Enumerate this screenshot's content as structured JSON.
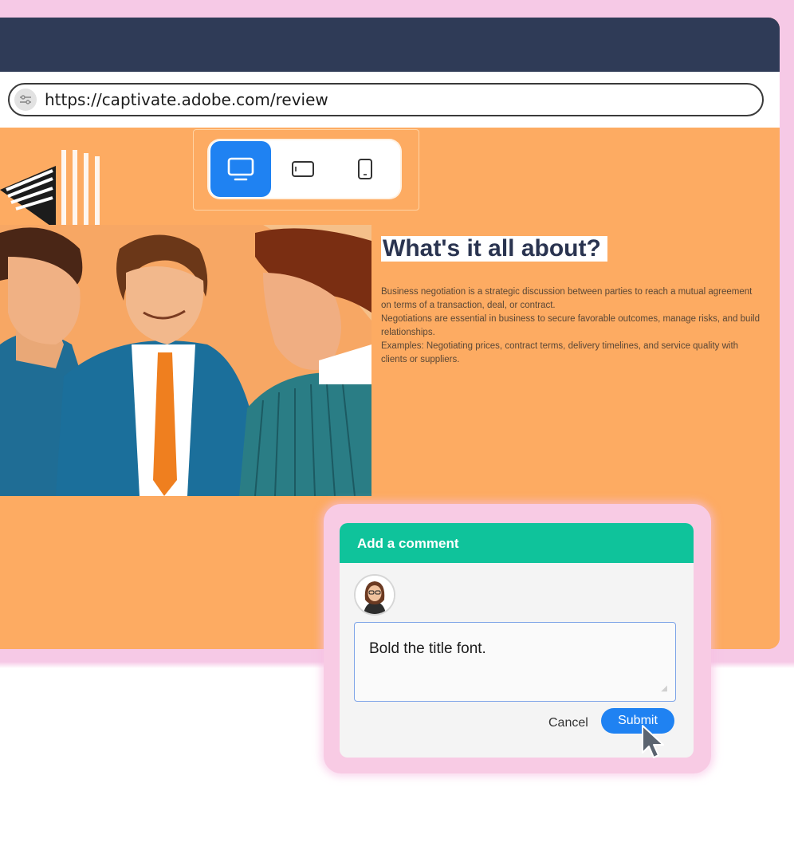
{
  "browser": {
    "url": "https://captivate.adobe.com/review",
    "site_icon": "site-settings-icon"
  },
  "device_toggle": {
    "options": [
      {
        "icon": "desktop-icon",
        "active": true
      },
      {
        "icon": "tablet-icon",
        "active": false
      },
      {
        "icon": "mobile-icon",
        "active": false
      }
    ]
  },
  "slide": {
    "title": "What's it all about?",
    "paragraphs": [
      "Business negotiation is a strategic discussion between parties to reach a mutual agreement on terms of a transaction, deal, or contract.",
      "Negotiations are essential in business to secure favorable outcomes, manage risks, and build relationships.",
      "Examples: Negotiating prices, contract terms, delivery timelines, and service quality with clients or suppliers."
    ]
  },
  "comment": {
    "header": "Add a comment",
    "text": "Bold the title font.",
    "cancel_label": "Cancel",
    "submit_label": "Submit"
  },
  "colors": {
    "titlebar": "#2f3b57",
    "slide_bg": "#fdab62",
    "accent_blue": "#1f82f2",
    "comment_header": "#0fc39b",
    "frame_pink": "#f6c9e6"
  }
}
